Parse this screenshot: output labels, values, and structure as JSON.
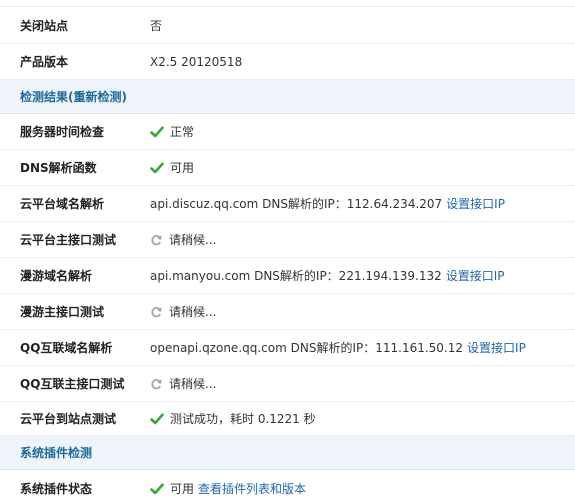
{
  "rows": {
    "close_site": {
      "label": "关闭站点",
      "value": "否"
    },
    "version": {
      "label": "产品版本",
      "value": "X2.5 20120518"
    },
    "section_check": {
      "title": "检测结果(重新检测)"
    },
    "server_time": {
      "label": "服务器时间检查",
      "value": "正常",
      "icon": "check-icon"
    },
    "dns_func": {
      "label": "DNS解析函数",
      "value": "可用",
      "icon": "check-icon"
    },
    "cloud_dns": {
      "label": "云平台域名解析",
      "value": "api.discuz.qq.com DNS解析的IP：112.64.234.207",
      "link": "设置接口IP"
    },
    "cloud_api": {
      "label": "云平台主接口测试",
      "value": "请稍候...",
      "icon": "loading-icon"
    },
    "manyou_dns": {
      "label": "漫游域名解析",
      "value": "api.manyou.com DNS解析的IP：221.194.139.132",
      "link": "设置接口IP"
    },
    "manyou_api": {
      "label": "漫游主接口测试",
      "value": "请稍候...",
      "icon": "loading-icon"
    },
    "qq_dns": {
      "label": "QQ互联域名解析",
      "value": "openapi.qzone.qq.com DNS解析的IP：111.161.50.12",
      "link": "设置接口IP"
    },
    "qq_api": {
      "label": "QQ互联主接口测试",
      "value": "请稍候...",
      "icon": "loading-icon"
    },
    "cloud_to_site": {
      "label": "云平台到站点测试",
      "value": "测试成功，耗时  0.1221 秒",
      "icon": "check-icon"
    },
    "section_plugin": {
      "title": "系统插件检测"
    },
    "plugin_status": {
      "label": "系统插件状态",
      "value": "可用",
      "link": "查看插件列表和版本"
    }
  },
  "colors": {
    "check": "#3aa63a",
    "link": "#2366a8",
    "section_title": "#1f6a99"
  }
}
